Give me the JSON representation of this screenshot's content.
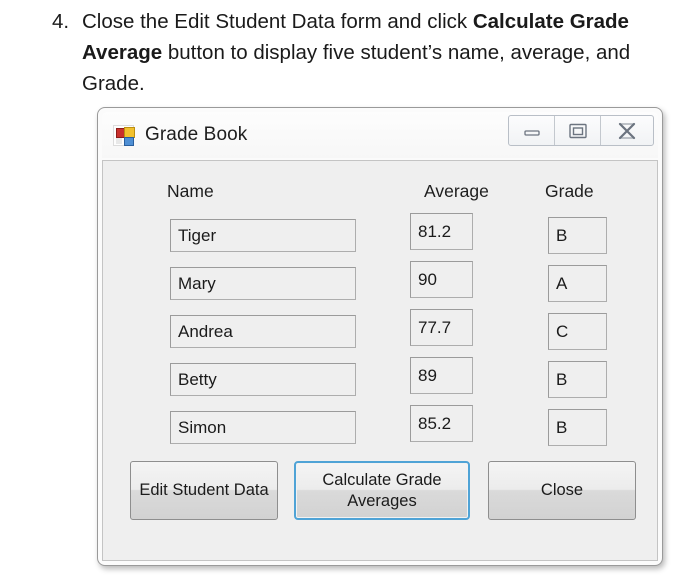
{
  "instruction": {
    "number": "4.",
    "text_before_bold": "Close the Edit Student Data form and click ",
    "bold_text": "Calculate Grade Average",
    "text_after_bold": " button to display five student’s name, average, and Grade."
  },
  "window": {
    "title": "Grade Book",
    "icon": "windows-forms-app-icon",
    "controls": {
      "minimize": "minimize-icon",
      "maximize": "maximize-icon",
      "close": "close-icon"
    }
  },
  "form": {
    "headers": {
      "name": "Name",
      "average": "Average",
      "grade": "Grade"
    },
    "rows": [
      {
        "name": "Tiger",
        "average": "81.2",
        "grade": "B"
      },
      {
        "name": "Mary",
        "average": "90",
        "grade": "A"
      },
      {
        "name": "Andrea",
        "average": "77.7",
        "grade": "C"
      },
      {
        "name": "Betty",
        "average": "89",
        "grade": "B"
      },
      {
        "name": "Simon",
        "average": "85.2",
        "grade": "B"
      }
    ],
    "buttons": {
      "edit": "Edit Student Data",
      "calculate": "Calculate Grade Averages",
      "close": "Close"
    }
  },
  "colors": {
    "focus_border": "#4fa3d6",
    "panel_bg": "#efefef",
    "titlebar_bg": "#fbfbfb",
    "text": "#1b1b1b"
  }
}
